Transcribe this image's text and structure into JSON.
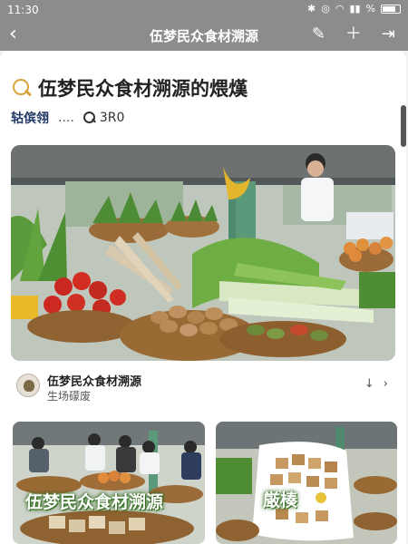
{
  "status_bar": {
    "time": "11:30",
    "battery": "%"
  },
  "navbar": {
    "title": "伍梦民众食材溯源"
  },
  "post": {
    "title": "伍梦民众食材溯源的煨熯",
    "author": "轱傧翎",
    "ellipsis": "....",
    "views": "3R0"
  },
  "source": {
    "name": "伍梦民众食材溯源",
    "subtitle": "生场礞废"
  },
  "thumbnails": [
    {
      "overlay": "伍梦民众食材溯源"
    },
    {
      "overlay": "厳楱"
    }
  ]
}
